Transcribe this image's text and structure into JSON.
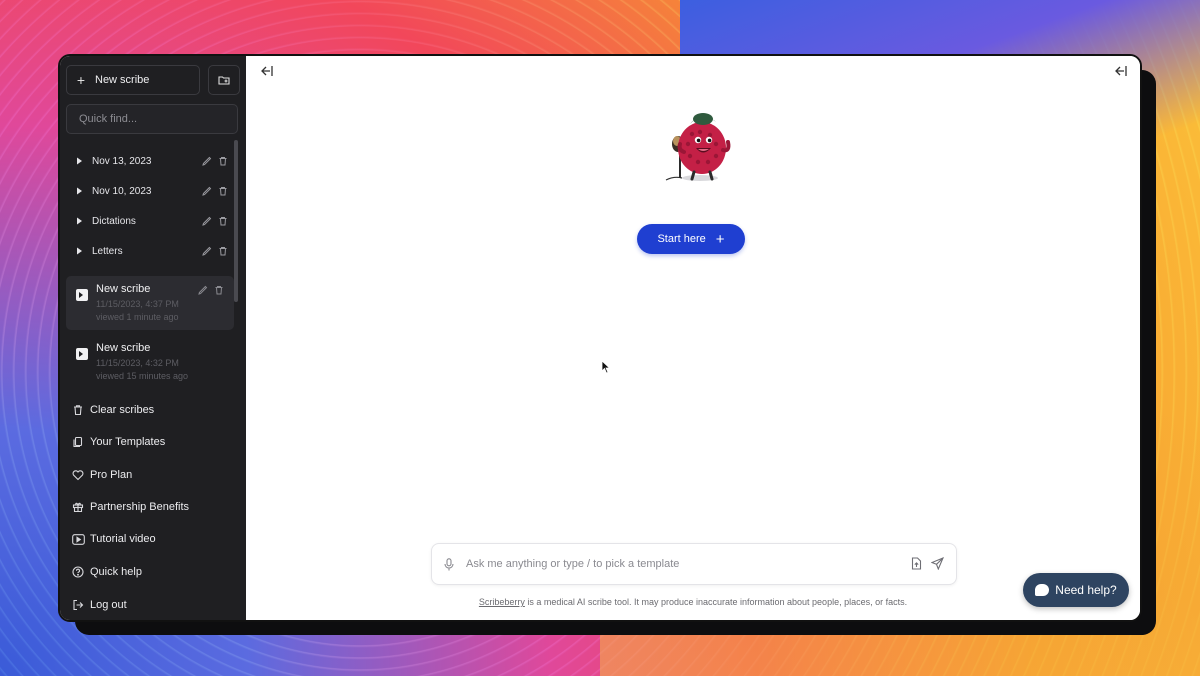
{
  "colors": {
    "sidebar_bg": "#1f1f22",
    "accent": "#1f3fd1",
    "help_button": "#2e4461"
  },
  "sidebar": {
    "new_scribe_label": "New scribe",
    "quick_find_placeholder": "Quick find...",
    "folders": [
      {
        "label": "Nov 13, 2023"
      },
      {
        "label": "Nov 10, 2023"
      },
      {
        "label": "Dictations"
      },
      {
        "label": "Letters"
      }
    ],
    "scribes": [
      {
        "title": "New scribe",
        "date": "11/15/2023, 4:37 PM",
        "viewed": "viewed 1 minute ago",
        "active": true
      },
      {
        "title": "New scribe",
        "date": "11/15/2023, 4:32 PM",
        "viewed": "viewed 15 minutes ago",
        "active": false
      }
    ],
    "menu": [
      {
        "label": "Clear scribes",
        "icon": "trash-icon"
      },
      {
        "label": "Your Templates",
        "icon": "templates-icon"
      },
      {
        "label": "Pro Plan",
        "icon": "heart-icon"
      },
      {
        "label": "Partnership Benefits",
        "icon": "gift-icon"
      },
      {
        "label": "Tutorial video",
        "icon": "play-icon"
      },
      {
        "label": "Quick help",
        "icon": "help-circle-icon"
      },
      {
        "label": "Log out",
        "icon": "logout-icon"
      }
    ]
  },
  "main": {
    "start_button_label": "Start here",
    "input_placeholder": "Ask me anything or type / to pick a template",
    "disclaimer_brand": "Scribeberry",
    "disclaimer_text": " is a medical AI scribe tool. It may produce inaccurate information about people, places, or facts."
  },
  "help_button_label": "Need help?"
}
